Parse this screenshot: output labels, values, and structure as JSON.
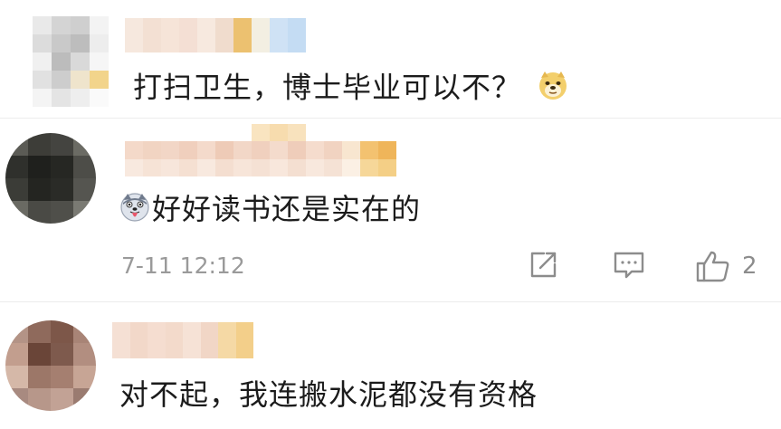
{
  "comments": [
    {
      "text": "打扫卫生，博士毕业可以不？",
      "trailing_emoji": "doge-emoji"
    },
    {
      "leading_emoji": "husky-tongue-emoji",
      "text": "好好读书还是实在的",
      "time": "7-11 12:12",
      "actions": {
        "repost_icon": "share-square-icon",
        "comment_icon": "comment-bubble-icon",
        "like_icon": "thumbs-up-icon",
        "like_count": "2"
      }
    },
    {
      "text": "对不起，我连搬水泥都没有资格"
    }
  ],
  "colors": {
    "background": "#ffffff",
    "text": "#1b1b1b",
    "meta": "#9a9a9a",
    "icon": "#8c8c8c",
    "divider": "#ececec"
  }
}
